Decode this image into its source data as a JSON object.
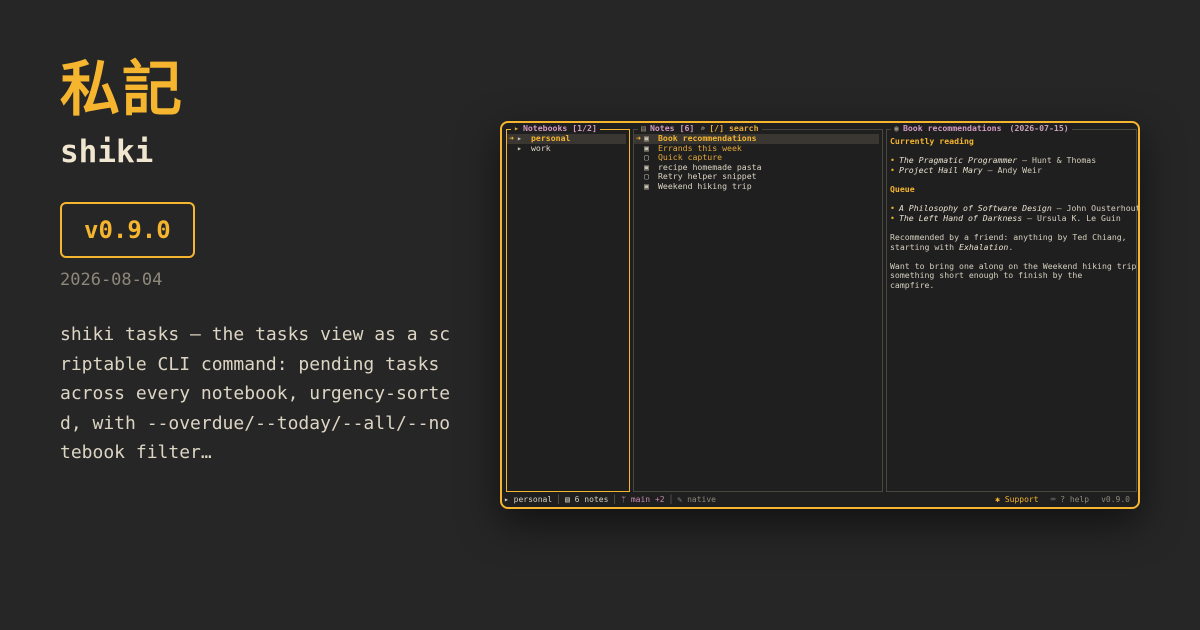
{
  "hero": {
    "kanji": "私記",
    "name": "shiki",
    "version": "v0.9.0",
    "date": "2026-08-04",
    "description": "shiki tasks — the tasks view as a scriptable CLI command: pending tasks across every notebook, urgency-sorted, with --overdue/--today/--all/--notebook filter…"
  },
  "colors": {
    "accent": "#f5b52e",
    "background": "#262626",
    "terminal_bg": "#1f1f1f",
    "pink": "#d59ac2"
  },
  "terminal": {
    "notebooks_pane": {
      "icon": "▸",
      "title": "Notebooks [1/2]",
      "items": [
        {
          "cursor": "➜",
          "icon": "▸",
          "label": "personal",
          "selected": true
        },
        {
          "cursor": "",
          "icon": "▸",
          "label": "work",
          "selected": false
        }
      ]
    },
    "notes_pane": {
      "icon": "▤",
      "title": "Notes [6]",
      "search_icon": "⌕",
      "search_label": "[/] search",
      "items": [
        {
          "cursor": "➜",
          "icon": "▣",
          "label": "Book recommendations",
          "selected": true,
          "amber": false
        },
        {
          "cursor": "",
          "icon": "▣",
          "label": "Errands this week",
          "selected": false,
          "amber": true
        },
        {
          "cursor": "",
          "icon": "▢",
          "label": "Quick capture",
          "selected": false,
          "amber": true
        },
        {
          "cursor": "",
          "icon": "▣",
          "label": "recipe homemade pasta",
          "selected": false,
          "amber": false
        },
        {
          "cursor": "",
          "icon": "▢",
          "label": "Retry helper snippet",
          "selected": false,
          "amber": false
        },
        {
          "cursor": "",
          "icon": "▣",
          "label": "Weekend hiking trip",
          "selected": false,
          "amber": false
        }
      ]
    },
    "preview_pane": {
      "icon": "◉",
      "title": "Book recommendations",
      "date": "(2026-07-15)",
      "heading_reading": "Currently reading",
      "reading": [
        {
          "bullet": "•",
          "title": "The Pragmatic Programmer",
          "rest": " — Hunt & Thomas"
        },
        {
          "bullet": "•",
          "title": "Project Hail Mary",
          "rest": " — Andy Weir"
        }
      ],
      "heading_queue": "Queue",
      "queue": [
        {
          "bullet": "•",
          "title": "A Philosophy of Software Design",
          "rest": " — John Ousterhout"
        },
        {
          "bullet": "•",
          "title": "The Left Hand of Darkness",
          "rest": " — Ursula K. Le Guin"
        }
      ],
      "para1_line1": "Recommended by a friend: anything by Ted Chiang,",
      "para1_line2_pre": "starting with ",
      "para1_line2_em": "Exhalation",
      "para1_line2_post": ".",
      "para2_line1": "Want to bring one along on the Weekend hiking trip —",
      "para2_line2": "something short enough to finish by the",
      "para2_line3": "campfire."
    },
    "statusbar": {
      "notebook_icon": "▸",
      "notebook": "personal",
      "notes_icon": "▤",
      "notes_count": "6 notes",
      "branch_icon": "ᛘ",
      "branch": "main +2",
      "editor_icon": "✎",
      "editor": "native",
      "support_icon": "✱",
      "support": "Support",
      "help_icon": "⌨",
      "help": "? help",
      "version": "v0.9.0"
    }
  }
}
